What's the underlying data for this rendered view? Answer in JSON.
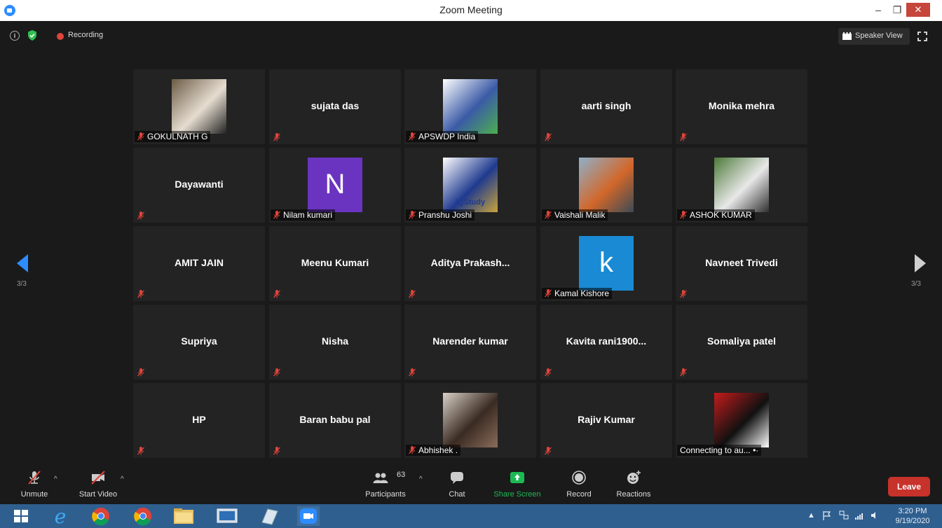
{
  "window": {
    "title": "Zoom Meeting",
    "minimize": "–",
    "maximize": "❐",
    "close": "✕"
  },
  "topbar": {
    "info_glyph": "i",
    "recording_label": "Recording",
    "speaker_view_label": "Speaker View"
  },
  "nav": {
    "page_left": "3/3",
    "page_right": "3/3"
  },
  "participants": [
    {
      "name": "GOKULNATH G",
      "display": "photo",
      "photo_colors": [
        "#6b5b45",
        "#e6ddd0",
        "#222"
      ]
    },
    {
      "name": "sujata das",
      "display": "name"
    },
    {
      "name": "APSWDP India",
      "display": "photo",
      "photo_colors": [
        "#ffffff",
        "#3b5ba6",
        "#4caf50"
      ]
    },
    {
      "name": "aarti singh",
      "display": "name"
    },
    {
      "name": "Monika mehra",
      "display": "name"
    },
    {
      "name": "Dayawanti",
      "display": "name"
    },
    {
      "name": "Nilam kumari",
      "display": "letter",
      "letter": "N",
      "color": "#6a34c0"
    },
    {
      "name": "Pranshu Joshi",
      "display": "photo",
      "photo_colors": [
        "#ffffff",
        "#1f3a8f",
        "#c9a43a"
      ],
      "photo_caption": "IQStudy"
    },
    {
      "name": "Vaishali Malik",
      "display": "photo",
      "photo_colors": [
        "#8fb0c9",
        "#d2672a",
        "#3c4a55"
      ]
    },
    {
      "name": "ASHOK KUMAR",
      "display": "photo",
      "photo_colors": [
        "#4d7a3a",
        "#e8e8e8",
        "#2f2f2f"
      ]
    },
    {
      "name": "AMIT JAIN",
      "display": "name"
    },
    {
      "name": "Meenu Kumari",
      "display": "name"
    },
    {
      "name": "Aditya  Prakash...",
      "display": "name"
    },
    {
      "name": "Kamal Kishore",
      "display": "letter",
      "letter": "k",
      "color": "#1a8ad4"
    },
    {
      "name": "Navneet Trivedi",
      "display": "name"
    },
    {
      "name": "Supriya",
      "display": "name"
    },
    {
      "name": "Nisha",
      "display": "name"
    },
    {
      "name": "Narender kumar",
      "display": "name"
    },
    {
      "name": "Kavita  rani1900...",
      "display": "name"
    },
    {
      "name": "Somaliya patel",
      "display": "name"
    },
    {
      "name": "HP",
      "display": "name"
    },
    {
      "name": "Baran babu pal",
      "display": "name"
    },
    {
      "name": "Abhishek .",
      "display": "photo",
      "photo_colors": [
        "#d9d2c8",
        "#3a2a22",
        "#8a6d5a"
      ]
    },
    {
      "name": "Rajiv Kumar",
      "display": "name"
    },
    {
      "name": "Connecting to au... •·",
      "display": "photo",
      "photo_colors": [
        "#c41b1b",
        "#111111",
        "#ffffff"
      ],
      "no_mute": true
    }
  ],
  "toolbar": {
    "unmute": "Unmute",
    "start_video": "Start Video",
    "participants": "Participants",
    "participants_count": "63",
    "chat": "Chat",
    "share_screen": "Share Screen",
    "record": "Record",
    "reactions": "Reactions",
    "leave": "Leave",
    "caret": "^"
  },
  "taskbar": {
    "time": "3:20 PM",
    "date": "9/19/2020"
  },
  "colors": {
    "share_green": "#1db954",
    "leave_red": "#c7322a",
    "tile_bg": "#232323",
    "mute_red": "#e0443a"
  }
}
